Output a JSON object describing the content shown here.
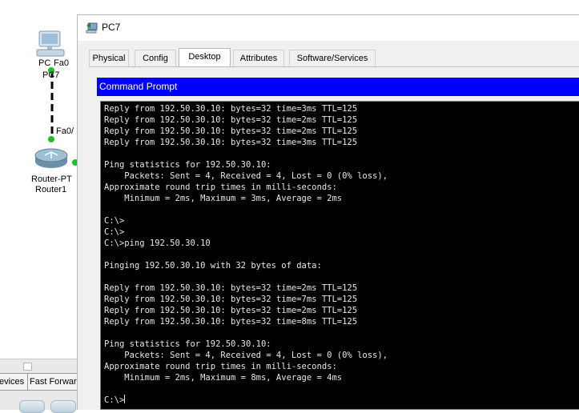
{
  "topology": {
    "pc": {
      "port_label": "Fa0",
      "type_label": "PC",
      "name": "PC7",
      "icon": "pc-icon"
    },
    "router": {
      "port_label": "Fa0/",
      "type_label": "Router-PT",
      "name": "Router1",
      "icon": "router-icon"
    },
    "link_color": "#000000",
    "port_status_color": "#1fbf2a"
  },
  "bottom_panel": {
    "tabs": [
      "evices",
      "Fast Forward"
    ]
  },
  "window": {
    "title": "PC7",
    "icon": "pc-window-icon",
    "tabs": [
      {
        "label": "Physical",
        "active": false
      },
      {
        "label": "Config",
        "active": false
      },
      {
        "label": "Desktop",
        "active": true
      },
      {
        "label": "Attributes",
        "active": false
      },
      {
        "label": "Software/Services",
        "active": false
      }
    ]
  },
  "command_prompt": {
    "header": "Command Prompt",
    "header_color": "#0000ff",
    "lines": [
      "Reply from 192.50.30.10: bytes=32 time=3ms TTL=125",
      "Reply from 192.50.30.10: bytes=32 time=2ms TTL=125",
      "Reply from 192.50.30.10: bytes=32 time=2ms TTL=125",
      "Reply from 192.50.30.10: bytes=32 time=3ms TTL=125",
      "",
      "Ping statistics for 192.50.30.10:",
      "    Packets: Sent = 4, Received = 4, Lost = 0 (0% loss),",
      "Approximate round trip times in milli-seconds:",
      "    Minimum = 2ms, Maximum = 3ms, Average = 2ms",
      "",
      "C:\\>",
      "C:\\>",
      "C:\\>ping 192.50.30.10",
      "",
      "Pinging 192.50.30.10 with 32 bytes of data:",
      "",
      "Reply from 192.50.30.10: bytes=32 time=2ms TTL=125",
      "Reply from 192.50.30.10: bytes=32 time=7ms TTL=125",
      "Reply from 192.50.30.10: bytes=32 time=2ms TTL=125",
      "Reply from 192.50.30.10: bytes=32 time=8ms TTL=125",
      "",
      "Ping statistics for 192.50.30.10:",
      "    Packets: Sent = 4, Received = 4, Lost = 0 (0% loss),",
      "Approximate round trip times in milli-seconds:",
      "    Minimum = 2ms, Maximum = 8ms, Average = 4ms",
      "",
      "C:\\>"
    ]
  }
}
